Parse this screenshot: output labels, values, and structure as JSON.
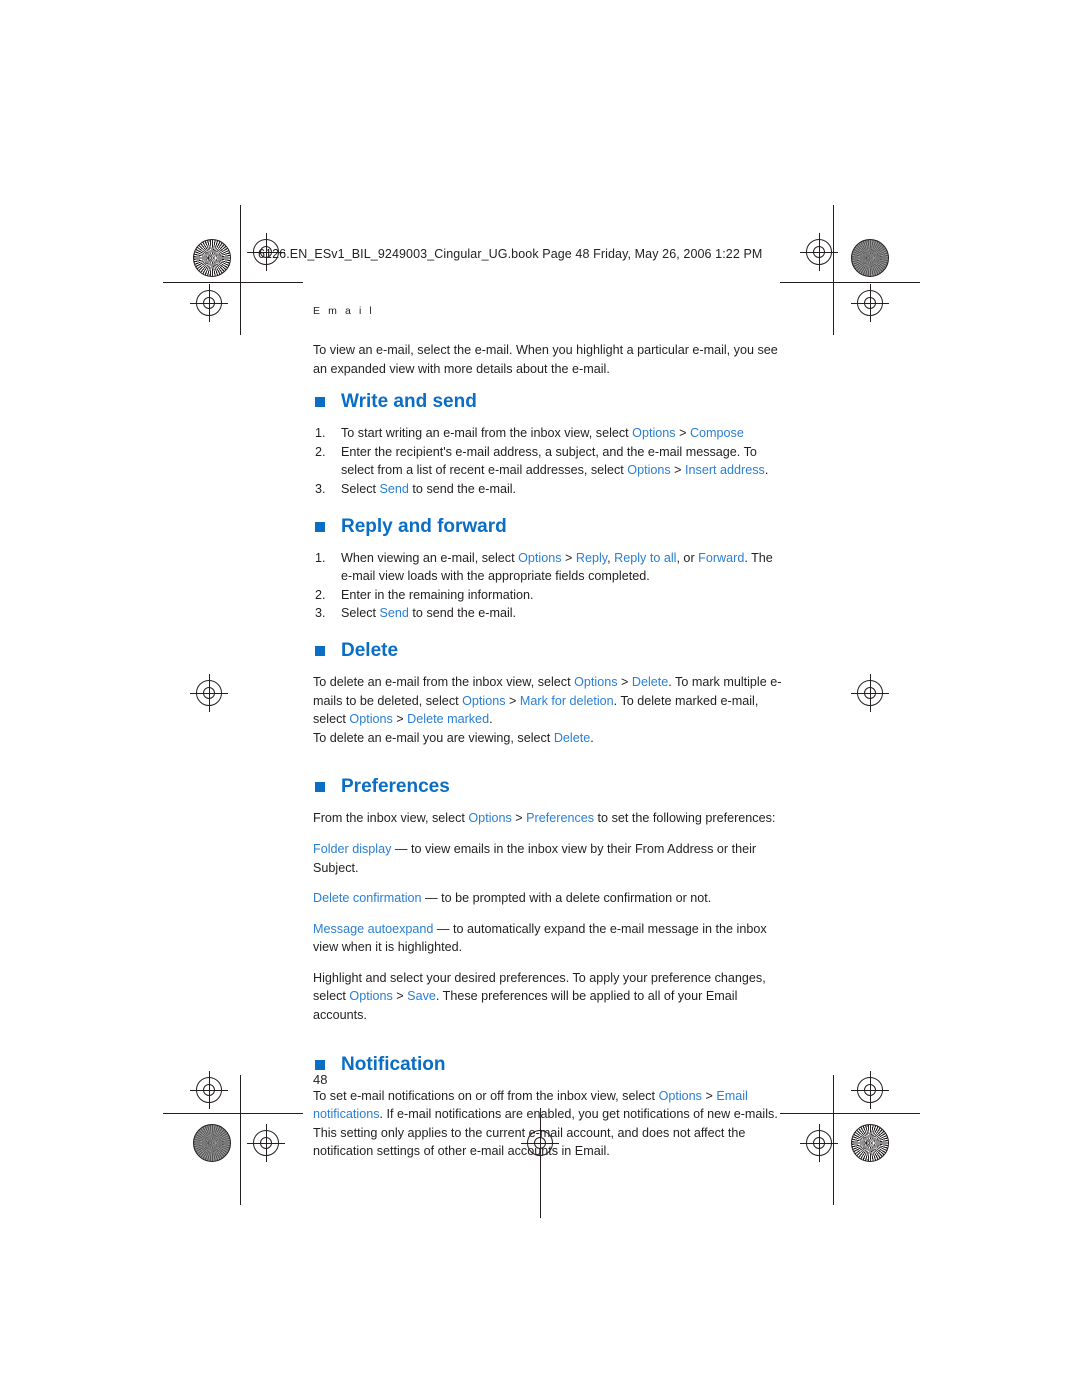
{
  "header": {
    "filename_line": "6126.EN_ESv1_BIL_9249003_Cingular_UG.book  Page 48  Friday, May 26, 2006  1:22 PM"
  },
  "running_head": "E m a i l",
  "page_number": "48",
  "intro": "To view an e-mail, select the e-mail. When you highlight a particular e-mail, you see an expanded view with more details about the e-mail.",
  "sections": [
    {
      "id": "write-and-send",
      "title": "Write and send",
      "steps": [
        {
          "num": "1.",
          "parts": [
            {
              "t": "To start writing an e-mail from the inbox view, select ",
              "c": "black"
            },
            {
              "t": "Options",
              "c": "blue"
            },
            {
              "t": " > ",
              "c": "black"
            },
            {
              "t": "Compose",
              "c": "blue"
            }
          ]
        },
        {
          "num": "2.",
          "parts": [
            {
              "t": "Enter the recipient's e-mail address, a subject, and the e-mail message. To select from a list of recent e-mail addresses, select ",
              "c": "black"
            },
            {
              "t": "Options",
              "c": "blue"
            },
            {
              "t": " > ",
              "c": "black"
            },
            {
              "t": "Insert address",
              "c": "blue"
            },
            {
              "t": ".",
              "c": "black"
            }
          ]
        },
        {
          "num": "3.",
          "parts": [
            {
              "t": "Select ",
              "c": "black"
            },
            {
              "t": "Send",
              "c": "blue"
            },
            {
              "t": " to send the e-mail.",
              "c": "black"
            }
          ]
        }
      ]
    },
    {
      "id": "reply-and-forward",
      "title": "Reply and forward",
      "steps": [
        {
          "num": "1.",
          "parts": [
            {
              "t": "When viewing an e-mail, select ",
              "c": "black"
            },
            {
              "t": "Options",
              "c": "blue"
            },
            {
              "t": " > ",
              "c": "black"
            },
            {
              "t": "Reply",
              "c": "blue"
            },
            {
              "t": ", ",
              "c": "black"
            },
            {
              "t": "Reply to all",
              "c": "blue"
            },
            {
              "t": ", or ",
              "c": "black"
            },
            {
              "t": "Forward",
              "c": "blue"
            },
            {
              "t": ". The e-mail view loads with the appropriate fields completed.",
              "c": "black"
            }
          ]
        },
        {
          "num": "2.",
          "parts": [
            {
              "t": "Enter in the remaining information.",
              "c": "black"
            }
          ]
        },
        {
          "num": "3.",
          "parts": [
            {
              "t": "Select ",
              "c": "black"
            },
            {
              "t": "Send",
              "c": "blue"
            },
            {
              "t": " to send the e-mail.",
              "c": "black"
            }
          ]
        }
      ]
    },
    {
      "id": "delete",
      "title": "Delete",
      "paragraphs": [
        {
          "parts": [
            {
              "t": "To delete an e-mail from the inbox view, select ",
              "c": "black"
            },
            {
              "t": "Options",
              "c": "blue"
            },
            {
              "t": " > ",
              "c": "black"
            },
            {
              "t": "Delete",
              "c": "blue"
            },
            {
              "t": ". To mark multiple e-mails to be deleted, select ",
              "c": "black"
            },
            {
              "t": "Options",
              "c": "blue"
            },
            {
              "t": " > ",
              "c": "black"
            },
            {
              "t": "Mark for deletion",
              "c": "blue"
            },
            {
              "t": ". To delete marked e-mail, select ",
              "c": "black"
            },
            {
              "t": "Options",
              "c": "blue"
            },
            {
              "t": " > ",
              "c": "black"
            },
            {
              "t": "Delete marked",
              "c": "blue"
            },
            {
              "t": ".",
              "c": "black"
            }
          ]
        },
        {
          "parts": [
            {
              "t": "To delete an e-mail you are viewing, select ",
              "c": "black"
            },
            {
              "t": "Delete",
              "c": "blue"
            },
            {
              "t": ".",
              "c": "black"
            }
          ]
        }
      ]
    },
    {
      "id": "preferences",
      "title": "Preferences",
      "paragraphs": [
        {
          "parts": [
            {
              "t": "From the inbox view, select ",
              "c": "black"
            },
            {
              "t": "Options",
              "c": "blue"
            },
            {
              "t": " > ",
              "c": "black"
            },
            {
              "t": "Preferences",
              "c": "blue"
            },
            {
              "t": " to set the following preferences:",
              "c": "black"
            }
          ]
        },
        {
          "parts": [
            {
              "t": "Folder display",
              "c": "blue"
            },
            {
              "t": " — to view emails in the inbox view by their From Address or their Subject.",
              "c": "black"
            }
          ]
        },
        {
          "parts": [
            {
              "t": "Delete confirmation",
              "c": "blue"
            },
            {
              "t": " — to be prompted with a delete confirmation or not.",
              "c": "black"
            }
          ]
        },
        {
          "parts": [
            {
              "t": "Message autoexpand",
              "c": "blue"
            },
            {
              "t": " — to automatically expand the e-mail message in the inbox view when it is highlighted.",
              "c": "black"
            }
          ]
        },
        {
          "parts": [
            {
              "t": "Highlight and select your desired preferences. To apply your preference changes, select ",
              "c": "black"
            },
            {
              "t": "Options",
              "c": "blue"
            },
            {
              "t": " > ",
              "c": "black"
            },
            {
              "t": "Save",
              "c": "blue"
            },
            {
              "t": ". These preferences will be applied to all of your Email accounts.",
              "c": "black"
            }
          ]
        }
      ]
    },
    {
      "id": "notification",
      "title": "Notification",
      "paragraphs": [
        {
          "parts": [
            {
              "t": "To set e-mail notifications on or off from the inbox view, select ",
              "c": "black"
            },
            {
              "t": "Options",
              "c": "blue"
            },
            {
              "t": " > ",
              "c": "black"
            },
            {
              "t": "Email notifications",
              "c": "blue"
            },
            {
              "t": ". If e-mail notifications are enabled, you get notifications of new e-mails. This setting only applies to the current e-mail account, and does not affect the notification settings of other e-mail accounts in Email.",
              "c": "black"
            }
          ]
        }
      ]
    }
  ],
  "colors": {
    "accent": "#0a6ec4",
    "link": "#2a7fd4",
    "text": "#231f20"
  }
}
